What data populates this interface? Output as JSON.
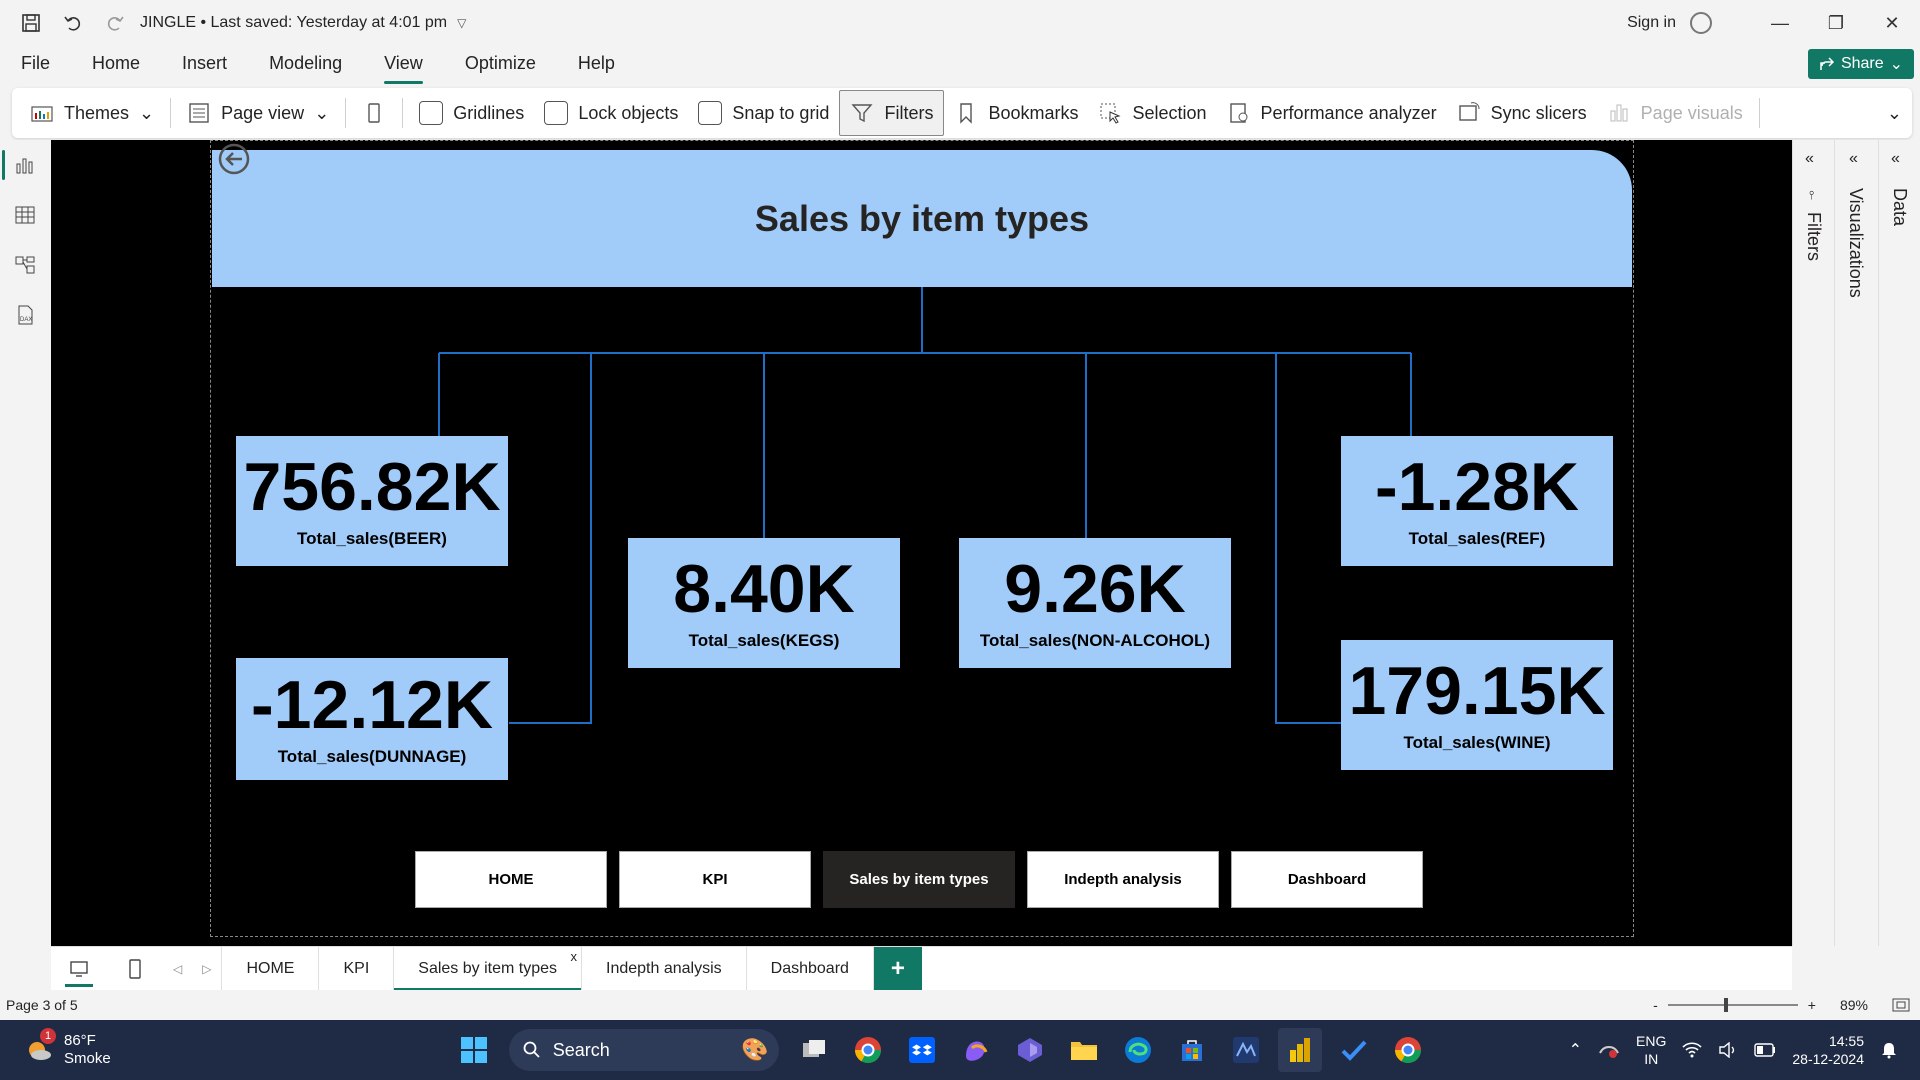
{
  "titlebar": {
    "title": "JINGLE • Last saved: Yesterday at 4:01 pm",
    "sign_in": "Sign in"
  },
  "menu": {
    "items": [
      "File",
      "Home",
      "Insert",
      "Modeling",
      "View",
      "Optimize",
      "Help"
    ],
    "active": "View",
    "share_label": "Share"
  },
  "ribbon": {
    "themes": "Themes",
    "page_view": "Page view",
    "gridlines": "Gridlines",
    "lock_objects": "Lock objects",
    "snap_to_grid": "Snap to grid",
    "filters": "Filters",
    "bookmarks": "Bookmarks",
    "selection": "Selection",
    "performance_analyzer": "Performance analyzer",
    "sync_slicers": "Sync slicers",
    "page_visuals": "Page visuals"
  },
  "report": {
    "header_title": "Sales by item types",
    "cards": [
      {
        "value": "756.82K",
        "label": "Total_sales(BEER)"
      },
      {
        "value": "-12.12K",
        "label": "Total_sales(DUNNAGE)"
      },
      {
        "value": "8.40K",
        "label": "Total_sales(KEGS)"
      },
      {
        "value": "9.26K",
        "label": "Total_sales(NON-ALCOHOL)"
      },
      {
        "value": "-1.28K",
        "label": "Total_sales(REF)"
      },
      {
        "value": "179.15K",
        "label": "Total_sales(WINE)"
      }
    ],
    "nav_buttons": [
      "HOME",
      "KPI",
      "Sales by item types",
      "Indepth analysis",
      "Dashboard"
    ],
    "nav_active": "Sales by item types",
    "header_color": "#a1cbf8",
    "line_color": "#1f6fc7"
  },
  "right_panes": {
    "filters": "Filters",
    "visualizations": "Visualizations",
    "data": "Data"
  },
  "tabs": {
    "items": [
      "HOME",
      "KPI",
      "Sales by item types",
      "Indepth analysis",
      "Dashboard"
    ],
    "active": "Sales by item types",
    "close": "x",
    "add": "+"
  },
  "status": {
    "page": "Page 3 of 5",
    "zoom": "89%",
    "zoom_minus": "-",
    "zoom_plus": "+"
  },
  "taskbar": {
    "weather_temp": "86°F",
    "weather_desc": "Smoke",
    "weather_badge": "1",
    "search": "Search",
    "lang_top": "ENG",
    "lang_bottom": "IN",
    "time": "14:55",
    "date": "28-12-2024"
  }
}
